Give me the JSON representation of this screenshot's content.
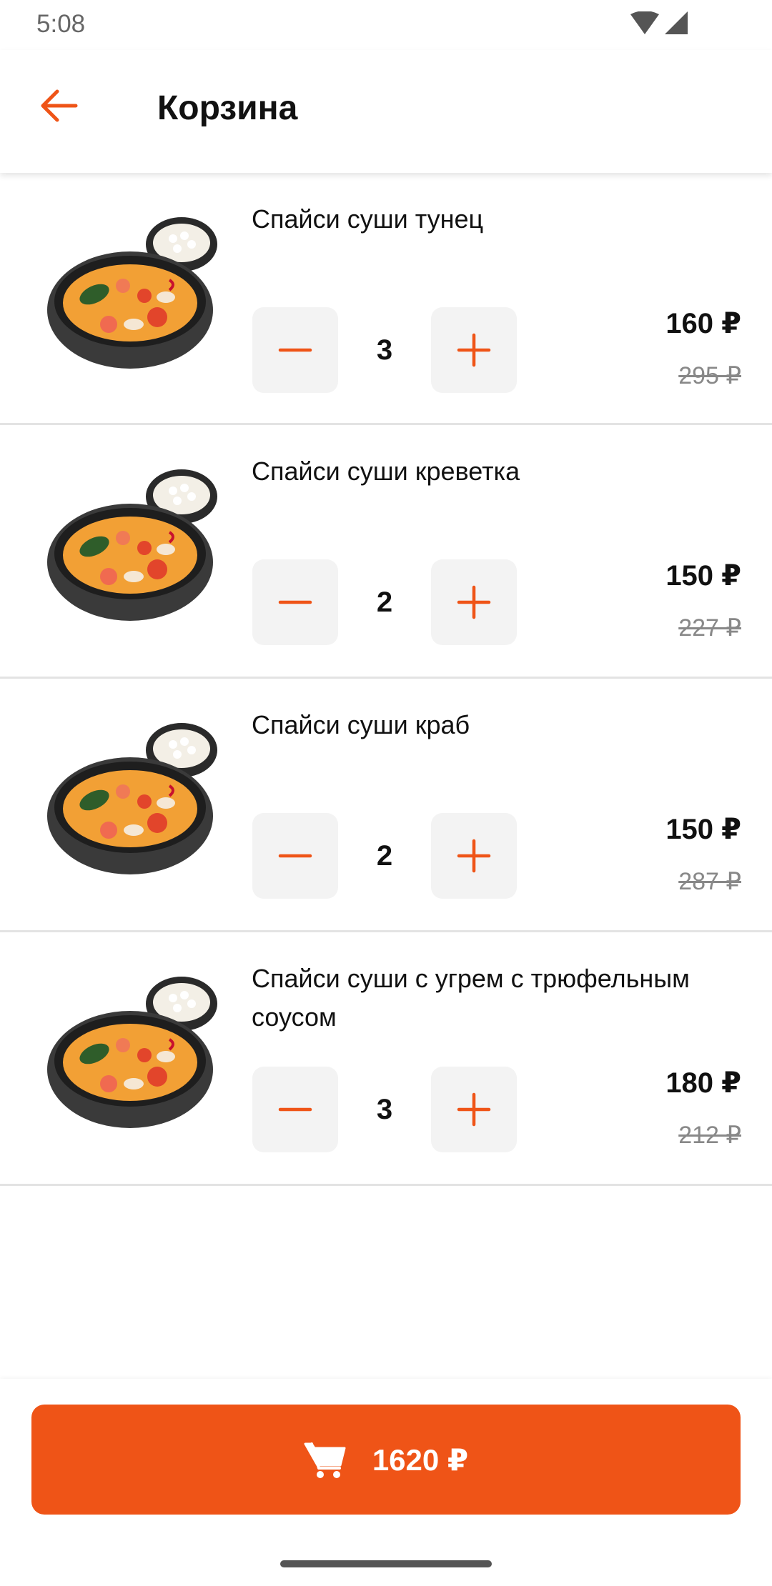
{
  "status_bar": {
    "time": "5:08",
    "icons": [
      "wifi-icon",
      "cellular-signal-icon"
    ]
  },
  "toolbar": {
    "back_icon": "arrow-left-icon",
    "title": "Корзина"
  },
  "colors": {
    "accent": "#EF5417",
    "qty_button_bg": "#F3F3F3",
    "old_price": "#888888",
    "divider": "#E3E3E3"
  },
  "cart": {
    "items": [
      {
        "name": "Спайси суши тунец",
        "quantity": "3",
        "price": "160 ₽",
        "old_price": "295 ₽"
      },
      {
        "name": "Спайси суши креветка",
        "quantity": "2",
        "price": "150 ₽",
        "old_price": "227 ₽"
      },
      {
        "name": "Спайси суши краб",
        "quantity": "2",
        "price": "150 ₽",
        "old_price": "287 ₽"
      },
      {
        "name": "Спайси суши с угрем с трюфельным соусом",
        "quantity": "3",
        "price": "180 ₽",
        "old_price": "212 ₽"
      }
    ]
  },
  "checkout": {
    "icon": "cart-icon",
    "total": "1620 ₽"
  }
}
